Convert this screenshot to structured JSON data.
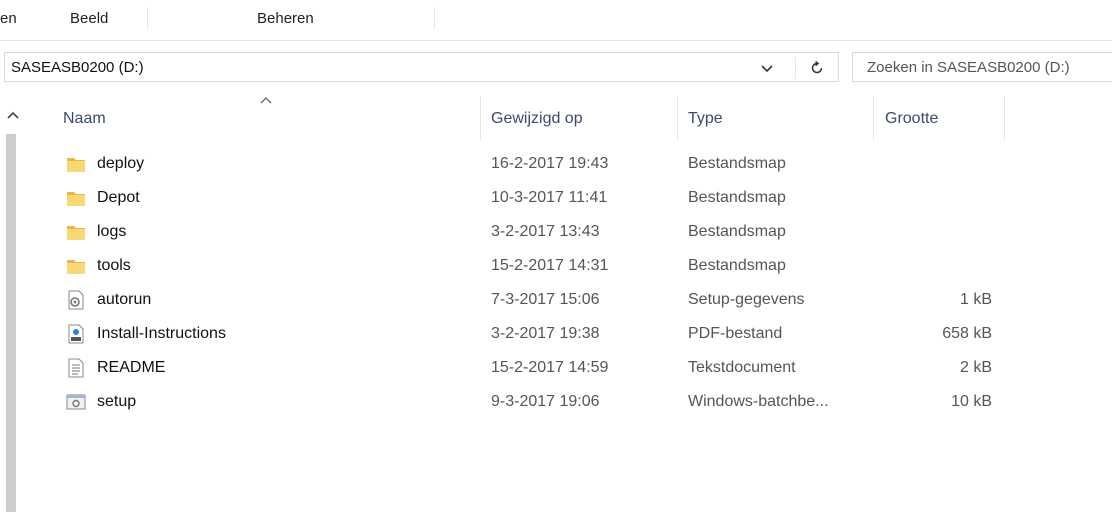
{
  "ribbon": {
    "tabs": [
      {
        "label": "en"
      },
      {
        "label": "Beeld"
      },
      {
        "label": "Beheren"
      }
    ]
  },
  "address": {
    "path": "SASEASB0200 (D:)"
  },
  "search": {
    "placeholder": "Zoeken in SASEASB0200 (D:)"
  },
  "columns": {
    "name": "Naam",
    "modified": "Gewijzigd op",
    "type": "Type",
    "size": "Grootte"
  },
  "files": [
    {
      "icon": "folder-icon",
      "name": "deploy",
      "modified": "16-2-2017 19:43",
      "type": "Bestandsmap",
      "size": ""
    },
    {
      "icon": "folder-icon",
      "name": "Depot",
      "modified": "10-3-2017 11:41",
      "type": "Bestandsmap",
      "size": ""
    },
    {
      "icon": "folder-icon",
      "name": "logs",
      "modified": "3-2-2017 13:43",
      "type": "Bestandsmap",
      "size": ""
    },
    {
      "icon": "folder-icon",
      "name": "tools",
      "modified": "15-2-2017 14:31",
      "type": "Bestandsmap",
      "size": ""
    },
    {
      "icon": "settings-file-icon",
      "name": "autorun",
      "modified": "7-3-2017 15:06",
      "type": "Setup-gegevens",
      "size": "1 kB"
    },
    {
      "icon": "pdf-file-icon",
      "name": "Install-Instructions",
      "modified": "3-2-2017 19:38",
      "type": "PDF-bestand",
      "size": "658 kB"
    },
    {
      "icon": "text-file-icon",
      "name": "README",
      "modified": "15-2-2017 14:59",
      "type": "Tekstdocument",
      "size": "2 kB"
    },
    {
      "icon": "batch-file-icon",
      "name": "setup",
      "modified": "9-3-2017 19:06",
      "type": "Windows-batchbe...",
      "size": "10 kB"
    }
  ],
  "colors": {
    "folder": "#f8d775",
    "header_text": "#3c4b6b",
    "scrollbar": "#cdcdcd"
  }
}
